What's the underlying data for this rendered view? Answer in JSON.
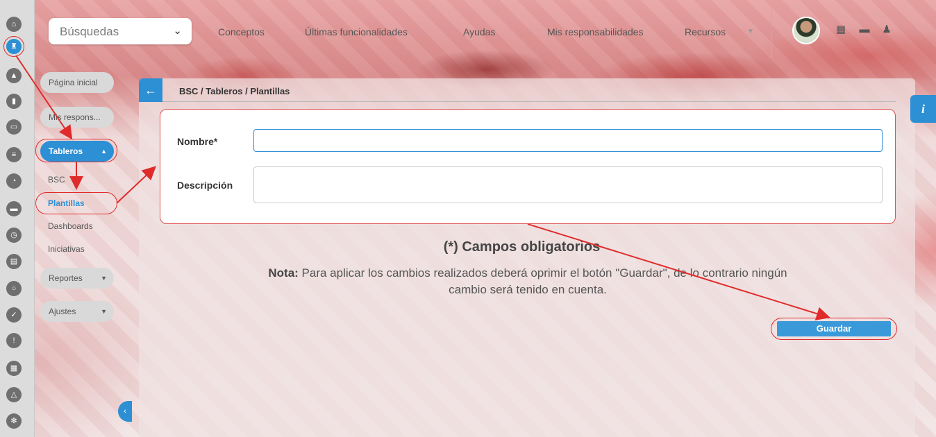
{
  "rail": {
    "icons": [
      "home-icon",
      "rook-icon",
      "pyramid-icon",
      "bar-chart-icon",
      "presentation-icon",
      "align-icon",
      "pie-chart-icon",
      "folder-icon",
      "clock-icon",
      "document-icon",
      "cycle-icon",
      "check-circle-icon",
      "warning-icon",
      "calendar-icon",
      "network-icon",
      "gear-icon"
    ]
  },
  "header": {
    "search_label": "Búsquedas",
    "nav": [
      "Conceptos",
      "Últimas funcionalidades",
      "Ayudas",
      "Mis responsabilidades",
      "Recursos"
    ]
  },
  "sidebar": {
    "home": "Página inicial",
    "my_resp": "Mis respons...",
    "tableros": "Tableros",
    "sub_bsc": "BSC",
    "sub_plantillas": "Plantillas",
    "sub_dashboards": "Dashboards",
    "sub_iniciativas": "Iniciativas",
    "reportes": "Reportes",
    "ajustes": "Ajustes"
  },
  "main": {
    "breadcrumb": "BSC / Tableros / Plantillas",
    "nombre_label": "Nombre*",
    "nombre_value": "",
    "descripcion_label": "Descripción",
    "descripcion_value": "",
    "required_note": "(*) Campos obligatorios",
    "note_bold": "Nota:",
    "note_text": " Para aplicar los cambios realizados deberá oprimir el botón \"Guardar\", de lo contrario ningún cambio será tenido en cuenta.",
    "save_label": "Guardar"
  },
  "info_label": "i",
  "colors": {
    "accent": "#2d8fd4",
    "highlight": "#e02b2b"
  }
}
